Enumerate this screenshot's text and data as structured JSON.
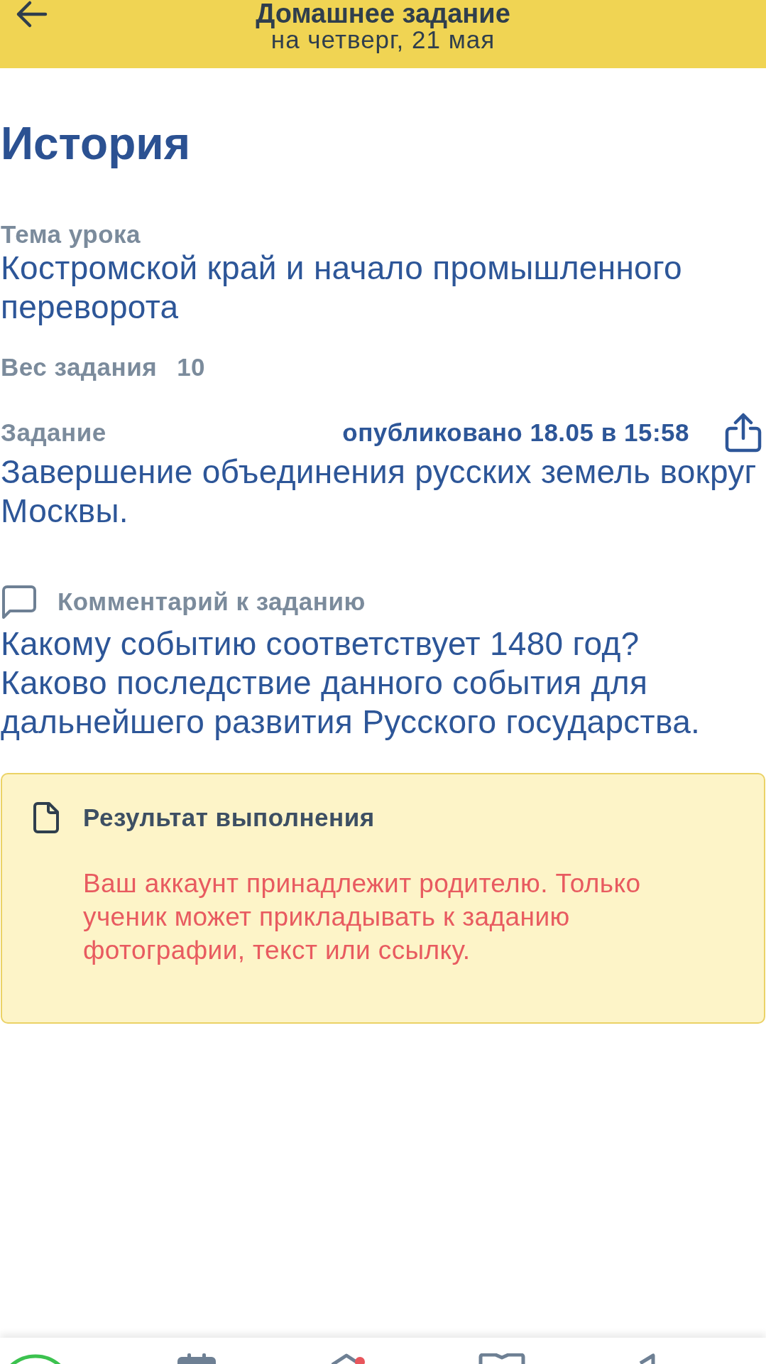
{
  "header": {
    "title": "Домашнее задание",
    "subtitle": "на четверг, 21 мая"
  },
  "subject": "История",
  "topic": {
    "label": "Тема урока",
    "value": "Костромской край и начало промышленного переворота"
  },
  "weight": {
    "label": "Вес задания",
    "value": "10"
  },
  "assignment": {
    "label": "Задание",
    "published": "опубликовано 18.05 в 15:58",
    "text": "Завершение объединения русских земель вокруг Москвы."
  },
  "comment": {
    "label": "Комментарий к заданию",
    "text": "Какому событию соответствует 1480 год?\nКаково последствие данного события для дальнейшего развития Русского государства."
  },
  "result": {
    "title": "Результат выполнения",
    "message": "Ваш аккаунт принадлежит родителю. Только ученик может прикладывать к заданию фотографии, текст или ссылку."
  },
  "bottom_nav": [
    {
      "badge": false
    },
    {
      "badge": false
    },
    {
      "badge": true
    },
    {
      "badge": false
    },
    {
      "badge": false
    }
  ]
}
